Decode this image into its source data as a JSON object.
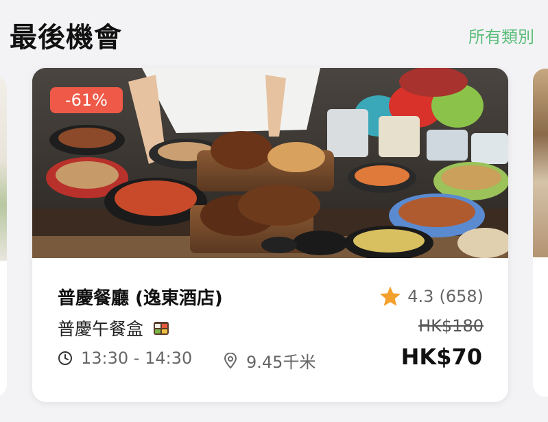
{
  "section": {
    "title": "最後機會",
    "all_link": "所有類別"
  },
  "card": {
    "discount": "-61%",
    "restaurant": "普慶餐廳 (逸東酒店)",
    "deal": "普慶午餐盒",
    "deal_icon": "bento-box-icon",
    "time": "13:30 - 14:30",
    "distance": "9.45千米",
    "rating": "4.3",
    "reviews": "(658)",
    "original_price": "HK$180",
    "price": "HK$70",
    "colors": {
      "badge": "#ee5a47",
      "star": "#f4a02c",
      "link": "#5bbd7a"
    }
  }
}
